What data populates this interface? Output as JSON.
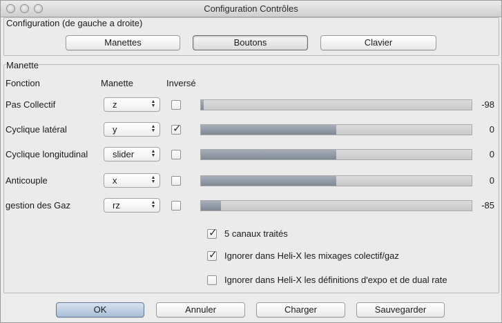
{
  "window": {
    "title": "Configuration Contrôles"
  },
  "config_group": {
    "label": "Configuration (de gauche a droite)",
    "buttons": [
      "Manettes",
      "Boutons",
      "Clavier"
    ],
    "selected": "Boutons"
  },
  "manette_group": {
    "label": "Manette",
    "headers": {
      "fonction": "Fonction",
      "manette": "Manette",
      "inverse": "Inversé"
    },
    "rows": [
      {
        "fonction": "Pas Collectif",
        "manette": "z",
        "inverse": false,
        "level": 0.01,
        "value": "-98"
      },
      {
        "fonction": "Cyclique latéral",
        "manette": "y",
        "inverse": true,
        "level": 0.5,
        "value": "0"
      },
      {
        "fonction": "Cyclique longitudinal",
        "manette": "slider",
        "inverse": false,
        "level": 0.5,
        "value": "0"
      },
      {
        "fonction": "Anticouple",
        "manette": "x",
        "inverse": false,
        "level": 0.5,
        "value": "0"
      },
      {
        "fonction": "gestion des Gaz",
        "manette": "rz",
        "inverse": false,
        "level": 0.075,
        "value": "-85"
      }
    ],
    "options": [
      {
        "label": "5 canaux traités",
        "checked": true
      },
      {
        "label": "Ignorer dans Heli-X les mixages colectif/gaz",
        "checked": true
      },
      {
        "label": "Ignorer dans Heli-X les définitions d'expo et de dual rate",
        "checked": false
      }
    ]
  },
  "footer": {
    "ok": "OK",
    "annuler": "Annuler",
    "charger": "Charger",
    "sauvegarder": "Sauvegarder"
  },
  "icons": {
    "check": "✓",
    "combo_arrows": "▲▼"
  },
  "colors": {
    "default_button": "#a7bdd6",
    "bar_fill": "#8a939e"
  }
}
